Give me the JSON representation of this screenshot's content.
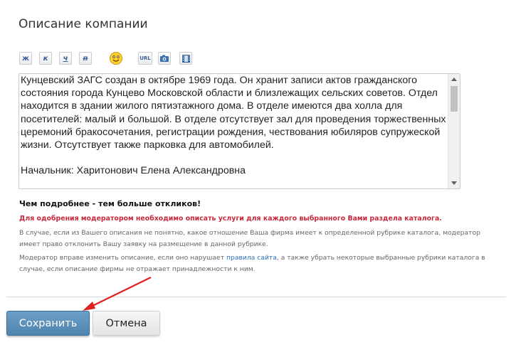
{
  "form": {
    "title": "Описание компании"
  },
  "toolbar": {
    "bold_label": "ж",
    "italic_label": "к",
    "underline_label": "ч",
    "strike_label": "п",
    "url_label": "URL",
    "icons": {
      "bold": "bold-icon",
      "italic": "italic-icon",
      "underline": "underline-icon",
      "strike": "strikethrough-icon",
      "smiley": "smiley-icon",
      "url": "link-icon",
      "image": "camera-icon",
      "video": "film-icon"
    }
  },
  "description": {
    "text": "Кунцевский ЗАГС создан в октябре 1969 года. Он хранит записи актов гражданского\nсостояния города Кунцево Московской области и близлежащих сельских советов. Отдел\nнаходится в здании жилого пятиэтажного дома. В отделе имеются два холла для\nпосетителей: малый и большой. В отделе отсутствует зал для проведения торжественных\nцеремоний бракосочетания, регистрации рождения, чествования юбиляров супружеской\nжизни. Отсутствует также парковка для автомобилей.\n\nНачальник: Харитонович Елена Александровна"
  },
  "hints": {
    "bold": "Чем подробнее - тем больше откликов!",
    "red": "Для одобрения модератором необходимо описать услуги для каждого выбранного Вами раздела каталога.",
    "gray1": "В случае, если из Вашего описания не понятно, какое отношение Ваша фирма имеет к определенной рубрике каталога, модератор имеет право отклонить Вашу заявку на размещение в данной рубрике.",
    "gray2_before": "Модератор вправе изменить описание, если оно нарушает ",
    "gray2_link": "правила сайта",
    "gray2_after": ", а также убрать некоторые выбранные рубрики каталога в случае, если описание фирмы не отражает принадлежности к ним."
  },
  "buttons": {
    "save": "Сохранить",
    "cancel": "Отмена"
  },
  "colors": {
    "save_button": "#5b8fb9",
    "warning_text": "#c8283c",
    "link": "#2b6fb6",
    "annotation_arrow": "#e02020"
  }
}
